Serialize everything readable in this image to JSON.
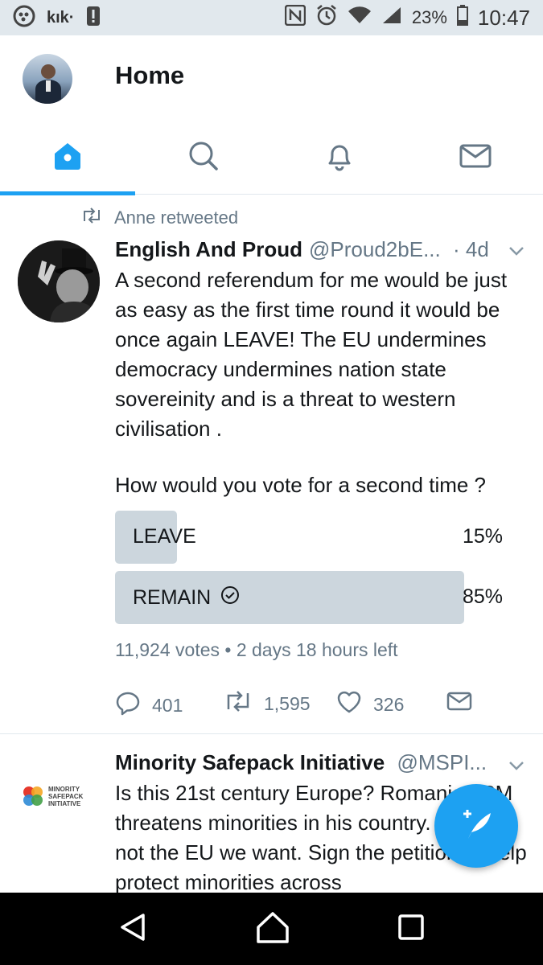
{
  "status_bar": {
    "kik_label": "kık·",
    "battery": "23%",
    "time": "10:47",
    "icons": [
      "bbm-icon",
      "kik-icon",
      "alert-icon",
      "nfc-icon",
      "alarm-icon",
      "wifi-icon",
      "signal-icon",
      "battery-icon"
    ]
  },
  "header": {
    "title": "Home"
  },
  "tabs": [
    {
      "name": "home",
      "icon": "home-icon",
      "active": true
    },
    {
      "name": "search",
      "icon": "search-icon",
      "active": false
    },
    {
      "name": "notifications",
      "icon": "bell-icon",
      "active": false
    },
    {
      "name": "messages",
      "icon": "mail-icon",
      "active": false
    }
  ],
  "tweet1": {
    "retweeted_by": "Anne retweeted",
    "name": "English And Proud",
    "handle": "@Proud2bE...",
    "time": "· 4d",
    "text": "A second referendum for me would be just as easy as the first time round it would be once again LEAVE! The EU undermines democracy undermines nation state sovereinity and is a threat to western civilisation .",
    "poll": {
      "question": "How would you vote for a second time ?",
      "options": [
        {
          "label": "LEAVE",
          "percent": "15%",
          "fraction": 0.15,
          "selected": false
        },
        {
          "label": "REMAIN",
          "percent": "85%",
          "fraction": 0.85,
          "selected": true
        }
      ],
      "meta": "11,924 votes • 2 days 18 hours left"
    },
    "actions": {
      "replies": "401",
      "retweets": "1,595",
      "likes": "326"
    }
  },
  "tweet2": {
    "name": "Minority Safepack Initiative",
    "handle": "@MSPI...",
    "logo_text": [
      "MINORITY",
      "SAFEPACK",
      "INITIATIVE"
    ],
    "text": "Is this 21st century Europe? Romanian PM threatens minorities in his country. This is not the EU we want. Sign the petition to help protect minorities across"
  },
  "colors": {
    "accent": "#1da1f2",
    "poll_bar": "#ccd6dd",
    "muted": "#657786"
  }
}
